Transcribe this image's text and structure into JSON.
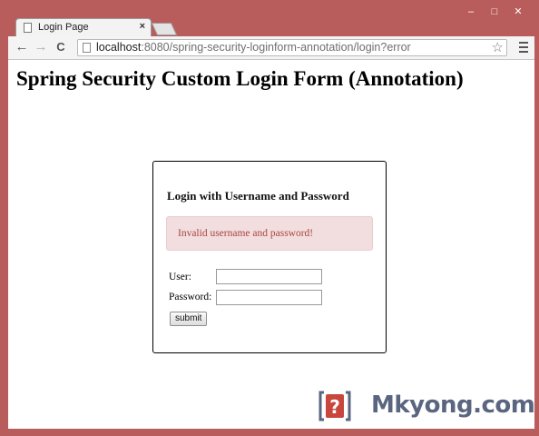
{
  "window": {
    "controls": {
      "minimize": "–",
      "maximize": "□",
      "close": "✕"
    }
  },
  "tab": {
    "title": "Login Page",
    "close": "×",
    "icon": "page-icon"
  },
  "toolbar": {
    "back": "←",
    "forward": "→",
    "reload": "C",
    "url_host": "localhost",
    "url_rest": ":8080/spring-security-loginform-annotation/login?error",
    "star": "☆"
  },
  "page": {
    "title": "Spring Security Custom Login Form (Annotation)"
  },
  "login": {
    "heading": "Login with Username and Password",
    "error": "Invalid username and password!",
    "user_label": "User:",
    "password_label": "Password:",
    "user_value": "",
    "password_value": "",
    "submit_label": "submit"
  },
  "watermark": {
    "text": "Mkyong.com",
    "icon_glyph": "?"
  },
  "colors": {
    "frame": "#b85d5b",
    "error_bg": "#f2dede",
    "error_text": "#a94442",
    "brand": "#5a6680"
  }
}
